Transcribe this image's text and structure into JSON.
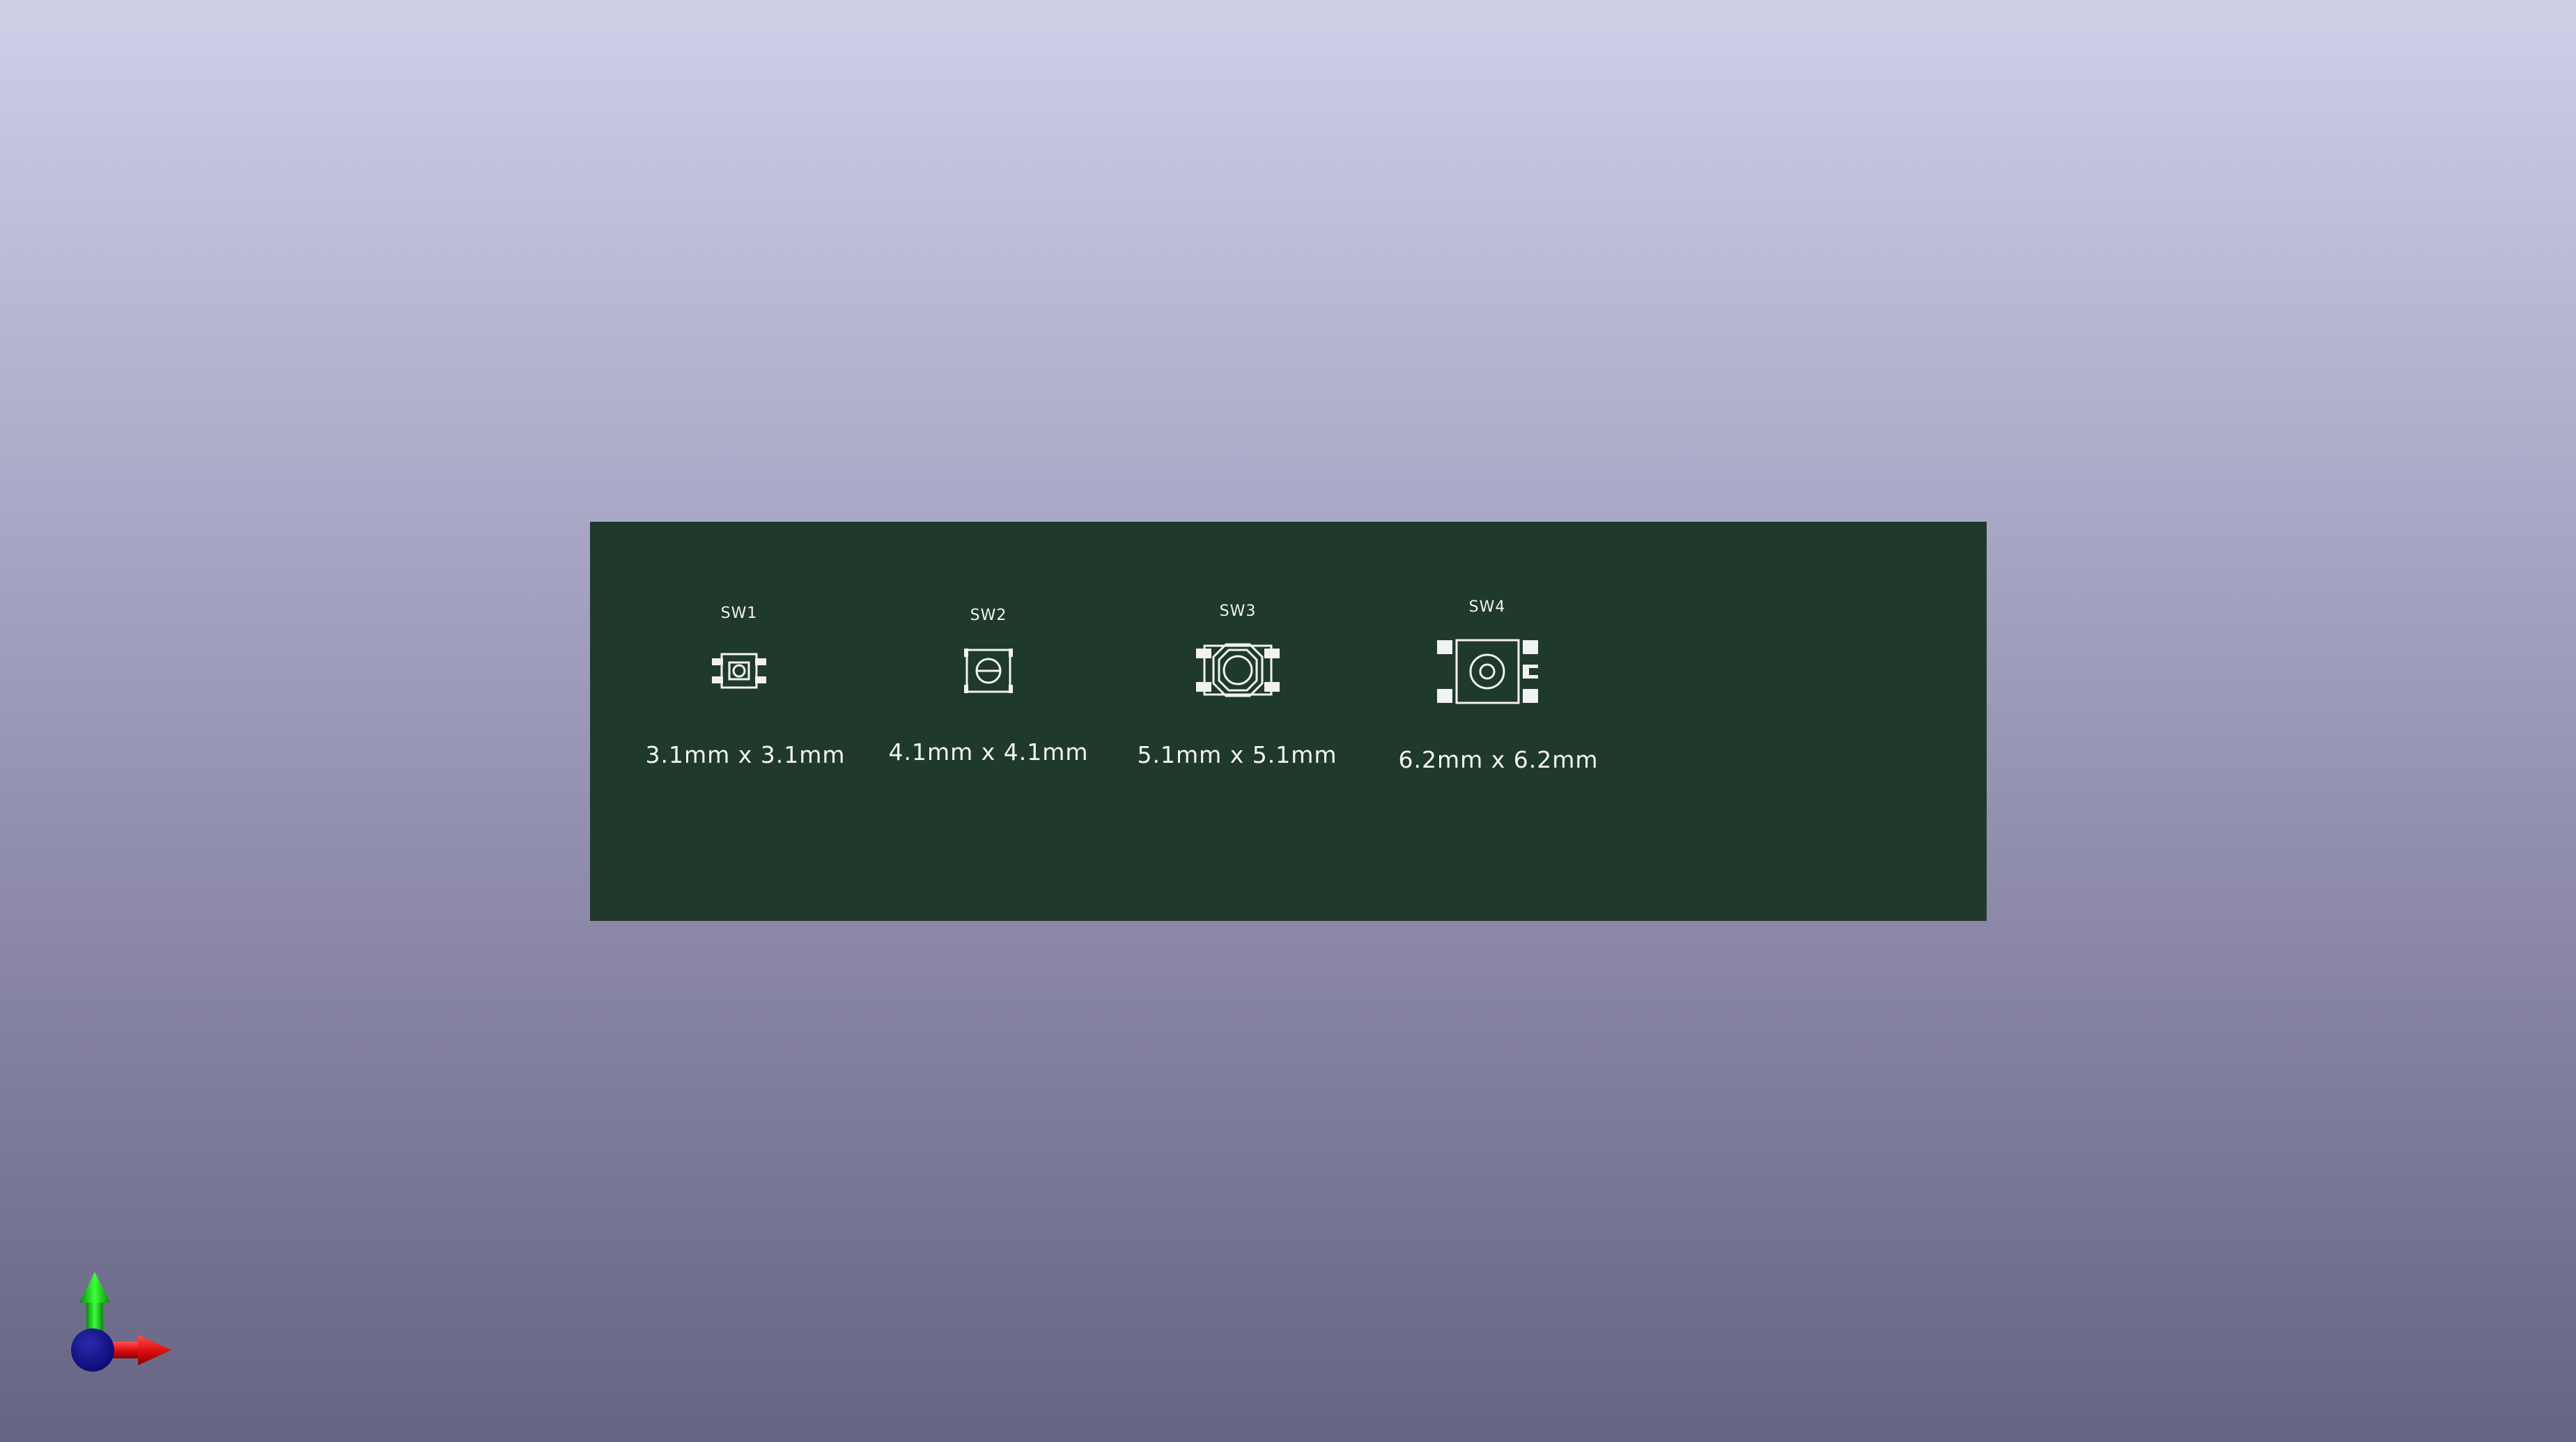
{
  "viewer": {
    "background_top": "#cfcfe8",
    "background_bottom": "#656482"
  },
  "board": {
    "color": "#1f3a2b",
    "silkscreen_color": "#f2f2f2",
    "footprints": [
      {
        "ref": "SW1",
        "size_label": "3.1mm x 3.1mm"
      },
      {
        "ref": "SW2",
        "size_label": "4.1mm x 4.1mm"
      },
      {
        "ref": "SW3",
        "size_label": "5.1mm x 5.1mm"
      },
      {
        "ref": "SW4",
        "size_label": "6.2mm x 6.2mm"
      }
    ]
  },
  "axis_gizmo": {
    "x_color": "#e01010",
    "y_color": "#10d010",
    "z_color": "#10108c",
    "icon": "xyz-axes-icon"
  }
}
